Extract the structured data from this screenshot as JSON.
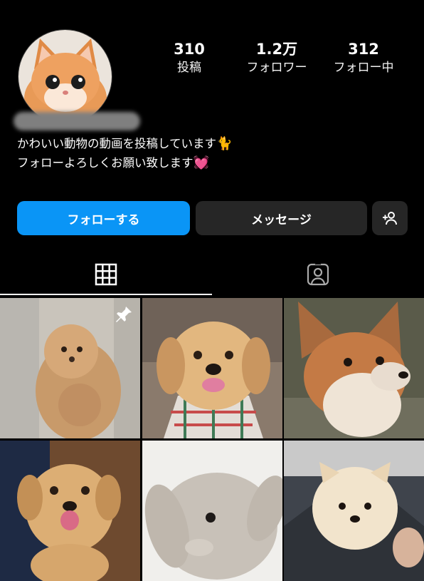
{
  "profile": {
    "avatar_icon": "kitten-avatar",
    "stats": [
      {
        "value": "310",
        "label": "投稿"
      },
      {
        "value": "1.2万",
        "label": "フォロワー"
      },
      {
        "value": "312",
        "label": "フォロー中"
      }
    ],
    "bio_line1": "かわいい動物の動画を投稿しています",
    "bio_line1_emoji": "🐈",
    "bio_line2": "フォローよろしくお願い致します",
    "bio_line2_emoji": "💓"
  },
  "actions": {
    "follow_label": "フォローする",
    "message_label": "メッセージ",
    "add_person_icon": "add-person-icon"
  },
  "tabs": [
    {
      "icon": "grid-icon",
      "active": true
    },
    {
      "icon": "tagged-person-icon",
      "active": false
    }
  ],
  "posts": [
    {
      "subject": "toy-poodle-puppy",
      "pinned": true
    },
    {
      "subject": "golden-retriever-puppy",
      "pinned": false
    },
    {
      "subject": "fox-kit",
      "pinned": false
    },
    {
      "subject": "golden-retriever-puppy-tongue",
      "pinned": false
    },
    {
      "subject": "lop-rabbit",
      "pinned": false
    },
    {
      "subject": "pomeranian-puppy",
      "pinned": false
    }
  ],
  "colors": {
    "background": "#000000",
    "primary_button": "#0a95f6",
    "secondary_button": "#262626"
  }
}
